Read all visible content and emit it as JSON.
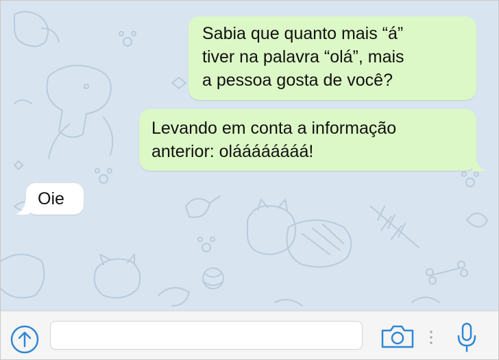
{
  "colors": {
    "wallpaper": "#d8e4ef",
    "wallpaper_doodles": "#b9cbdc",
    "outgoing_bubble": "#dcf8c6",
    "incoming_bubble": "#ffffff",
    "accent_icon": "#2f86d3"
  },
  "messages": [
    {
      "direction": "outgoing",
      "lines": [
        "Sabia que quanto mais “á”",
        "tiver na palavra “olá”, mais",
        "a pessoa gosta de você?"
      ]
    },
    {
      "direction": "outgoing",
      "lines": [
        "Levando em conta a informação",
        "anterior: oláááááááá!"
      ]
    },
    {
      "direction": "incoming",
      "lines": [
        "Oie"
      ]
    }
  ],
  "composer": {
    "value": "",
    "placeholder": "",
    "icons": {
      "upload": "upload-arrow-icon",
      "camera": "camera-icon",
      "divider": "vertical-dots",
      "mic": "microphone-icon"
    }
  }
}
